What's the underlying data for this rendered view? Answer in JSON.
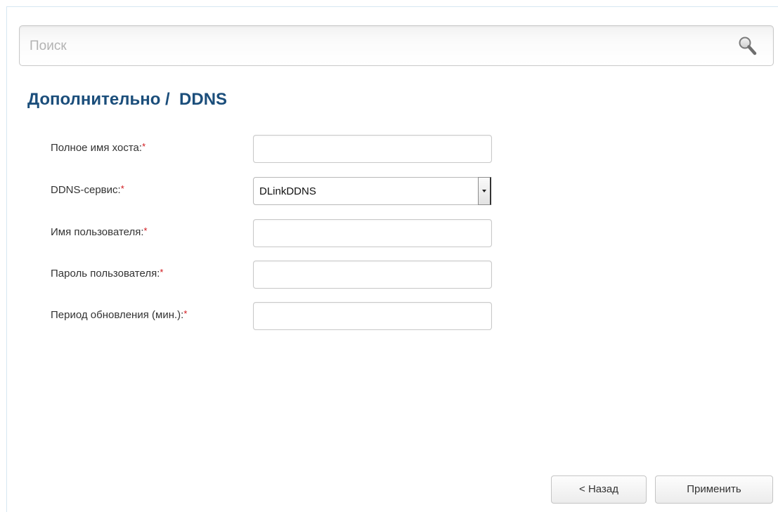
{
  "search": {
    "placeholder": "Поиск",
    "icon": "magnifier-icon"
  },
  "page": {
    "title": "Дополнительно /  DDNS"
  },
  "form": {
    "required_marker": "*",
    "hostname": {
      "label": "Полное имя хоста:",
      "value": ""
    },
    "service": {
      "label": "DDNS-сервис:",
      "value": "DLinkDDNS"
    },
    "username": {
      "label": "Имя пользователя:",
      "value": ""
    },
    "password": {
      "label": "Пароль пользователя:",
      "value": ""
    },
    "period": {
      "label": "Период обновления (мин.):",
      "value": ""
    }
  },
  "buttons": {
    "back_label": "< Назад",
    "apply_label": "Применить"
  },
  "colors": {
    "title": "#1b4e7b",
    "required": "#d0161b",
    "frame_border": "#d6e6f2"
  }
}
